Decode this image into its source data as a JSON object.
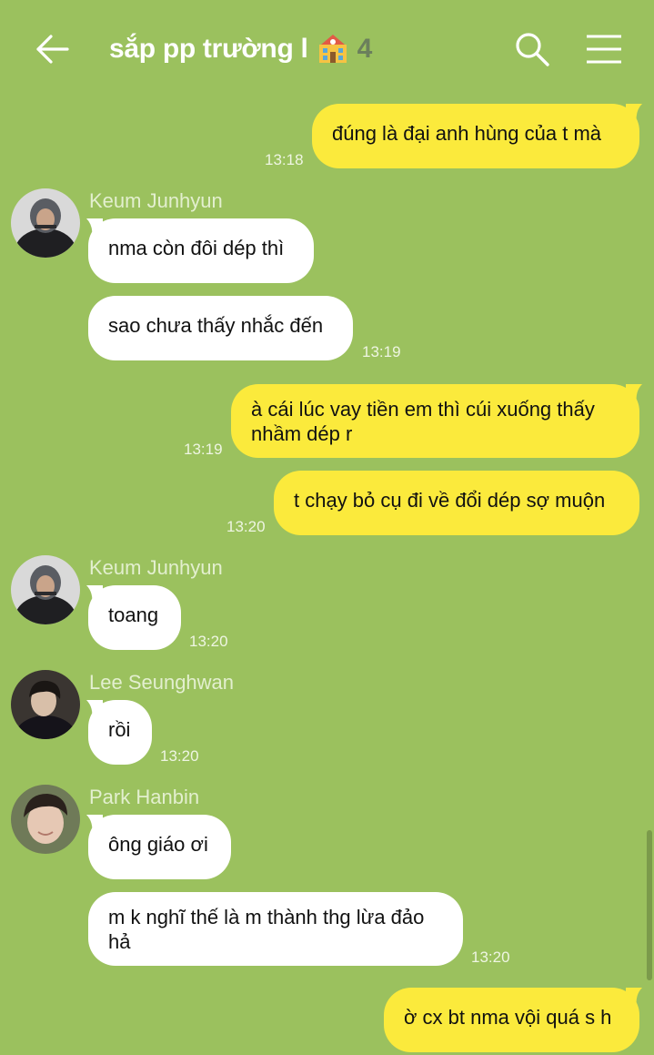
{
  "header": {
    "title": "sắp pp trường l",
    "title_emoji": "school-emoji",
    "member_count": "4"
  },
  "messages": [
    {
      "side": "me",
      "text": "đúng là đại anh hùng của t mà",
      "time": "13:18"
    },
    {
      "side": "them",
      "sender": "Keum Junhyun",
      "text": "nma còn đôi dép thì",
      "time": ""
    },
    {
      "side": "them",
      "text": "sao chưa thấy nhắc đến",
      "time": "13:19"
    },
    {
      "side": "me",
      "text": "à cái lúc vay tiền em thì cúi xuống thấy nhầm dép r",
      "time": "13:19"
    },
    {
      "side": "me",
      "text": "t chạy bỏ cụ đi về đổi dép sợ muộn",
      "time": "13:20"
    },
    {
      "side": "them",
      "sender": "Keum Junhyun",
      "text": "toang",
      "time": "13:20"
    },
    {
      "side": "them",
      "sender": "Lee Seunghwan",
      "text": "rồi",
      "time": "13:20"
    },
    {
      "side": "them",
      "sender": "Park Hanbin",
      "text": "ông giáo ơi",
      "time": ""
    },
    {
      "side": "them",
      "text": "m k nghĩ thế là m thành thg lừa đảo hả",
      "time": "13:20"
    },
    {
      "side": "me",
      "text": "ờ cx bt nma vội quá s h",
      "time": ""
    }
  ],
  "colors": {
    "background": "#9bc15e",
    "my_bubble": "#fbea3c",
    "their_bubble": "#ffffff",
    "timestamp": "#eef5e2",
    "sender_name": "#e3efcf"
  }
}
